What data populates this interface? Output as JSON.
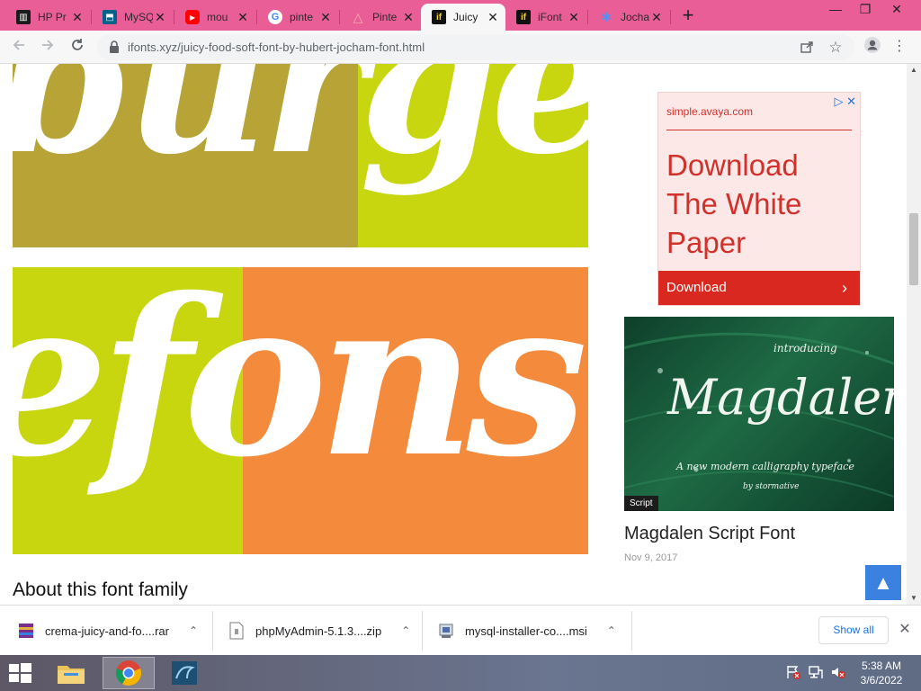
{
  "browser": {
    "tabs": [
      {
        "title": "HP Pr",
        "favicon": "hp-icon",
        "favicon_color": "#1b1b1b"
      },
      {
        "title": "MySQ",
        "favicon": "mysql-icon",
        "favicon_color": "#00618a"
      },
      {
        "title": "mou",
        "favicon": "youtube-icon",
        "favicon_color": "#ff0000"
      },
      {
        "title": "pinte",
        "favicon": "google-icon",
        "favicon_color": "#4285f4"
      },
      {
        "title": "Pinte",
        "favicon": "triangle-icon",
        "favicon_color": "#f29d9d"
      },
      {
        "title": "Juicy",
        "favicon": "ifonts-icon",
        "favicon_color": "#f2d21b",
        "active": true
      },
      {
        "title": "iFont",
        "favicon": "ifonts-icon",
        "favicon_color": "#f2d21b"
      },
      {
        "title": "Jocha",
        "favicon": "puzzle-icon",
        "favicon_color": "#5b8def"
      }
    ],
    "favicon_text": "if",
    "close_glyph": "✕",
    "new_tab_glyph": "+",
    "window_controls": {
      "minimize": "—",
      "restore": "❐",
      "close": "✕"
    },
    "url": "ifonts.xyz/juicy-food-soft-font-by-hubert-jocham-font.html",
    "theme_color": "#e95e96"
  },
  "page": {
    "banner_top_text": "burge",
    "banner_bottom_text": "efonst",
    "banner_colors": {
      "olive": "#b7a336",
      "lime": "#c7d60e",
      "orange": "#f38a3c"
    },
    "about_heading": "About this font family",
    "ad": {
      "domain": "simple.avaya.com",
      "headline": "Download The White Paper",
      "cta": "Download",
      "cta_arrow": "›",
      "choice_glyph": "▷ ✕"
    },
    "card": {
      "image_small_text": "introducing",
      "image_title": "Magdalen",
      "image_tagline": "A new modern calligraphy typeface",
      "image_signature": "by stormative",
      "category_tag": "Script",
      "title": "Magdalen Script Font",
      "date": "Nov 9, 2017"
    },
    "back_to_top_glyph": "▲",
    "scroll_up_glyph": "▲",
    "scroll_down_glyph": "▼"
  },
  "downloads": {
    "items": [
      {
        "filename": "crema-juicy-and-fo....rar",
        "icon": "winrar-icon"
      },
      {
        "filename": "phpMyAdmin-5.1.3....zip",
        "icon": "zip-file-icon"
      },
      {
        "filename": "mysql-installer-co....msi",
        "icon": "installer-icon"
      }
    ],
    "chevron": "⌃",
    "show_all": "Show all",
    "close_glyph": "✕"
  },
  "taskbar": {
    "time": "5:38 AM",
    "date": "3/6/2022"
  }
}
